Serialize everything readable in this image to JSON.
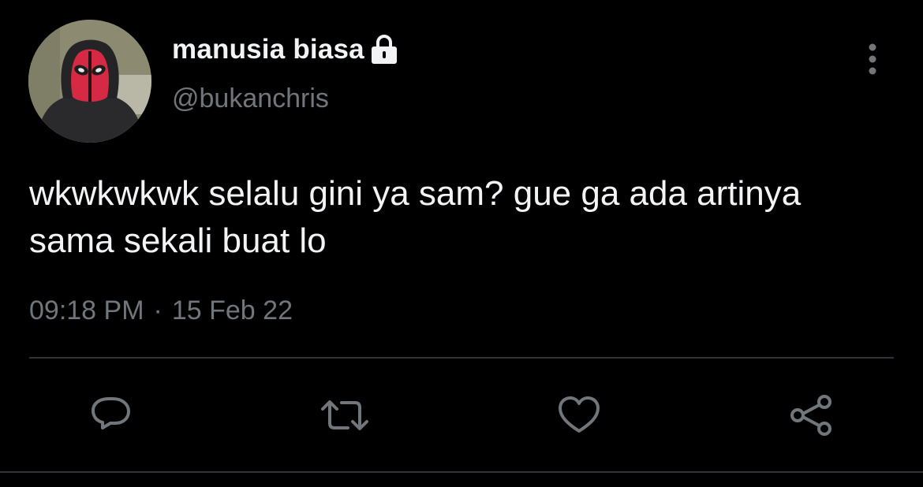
{
  "user": {
    "display_name": "manusia biasa",
    "handle": "@bukanchris",
    "protected": true,
    "avatar": "masked-hooded-person-avatar"
  },
  "tweet": {
    "text": "wkwkwkwk selalu gini ya sam? gue ga ada artinya sama sekali buat lo",
    "time": "09:18 PM",
    "separator": "·",
    "date": "15 Feb 22"
  },
  "actions": [
    {
      "icon": "reply-icon"
    },
    {
      "icon": "retweet-icon"
    },
    {
      "icon": "like-icon"
    },
    {
      "icon": "share-icon"
    }
  ],
  "colors": {
    "background": "#000000",
    "primary_text": "#f2f3f4",
    "secondary_text": "#71767b",
    "divider": "#2f3336"
  }
}
